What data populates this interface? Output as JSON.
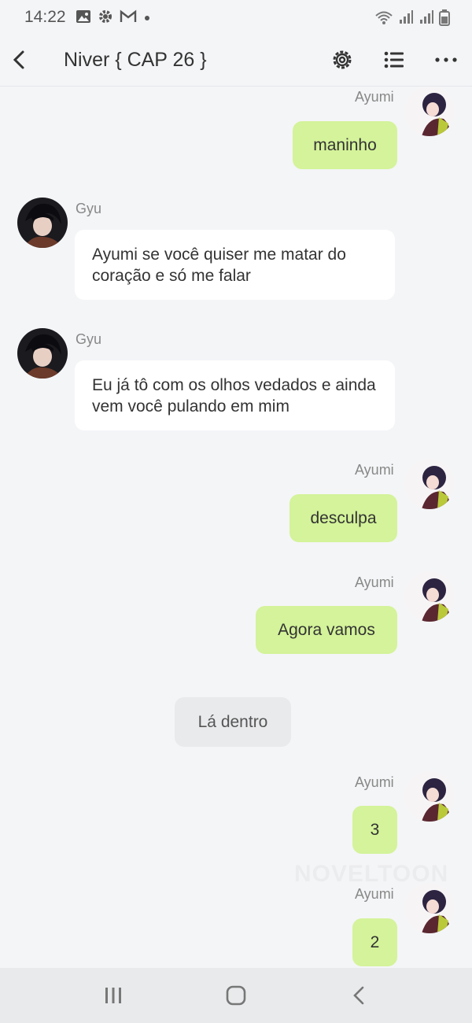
{
  "status": {
    "time": "14:22"
  },
  "header": {
    "title": "Niver { CAP 26 }"
  },
  "messages": [
    {
      "from": "Ayumi",
      "side": "right",
      "text": "maninho"
    },
    {
      "from": "Gyu",
      "side": "left",
      "text": "Ayumi se você quiser me matar do coração e só me falar"
    },
    {
      "from": "Gyu",
      "side": "left",
      "text": "Eu já tô com os olhos vedados e ainda vem você pulando em mim"
    },
    {
      "from": "Ayumi",
      "side": "right",
      "text": "desculpa"
    },
    {
      "from": "Ayumi",
      "side": "right",
      "text": "Agora vamos"
    },
    {
      "type": "narration",
      "text": "Lá dentro"
    },
    {
      "from": "Ayumi",
      "side": "right",
      "text": "3"
    },
    {
      "from": "Ayumi",
      "side": "right",
      "text": "2"
    }
  ],
  "watermark": "NOVELTOON",
  "colors": {
    "my_bubble": "#d4f39a",
    "their_bubble": "#ffffff",
    "background": "#f4f5f7"
  }
}
